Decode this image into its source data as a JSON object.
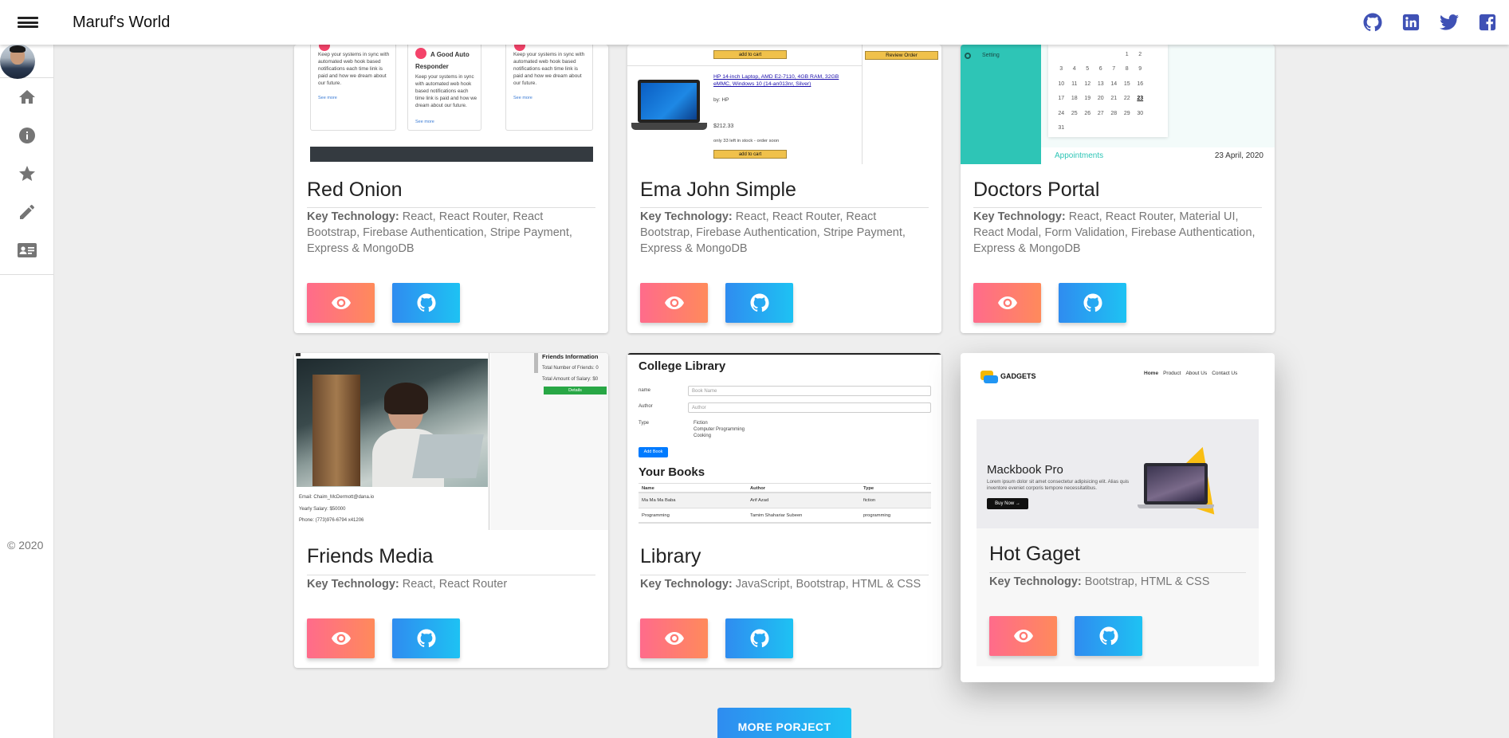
{
  "app": {
    "title": "Maruf's World"
  },
  "social": [
    {
      "icon": "github-icon",
      "label": "GitHub"
    },
    {
      "icon": "linkedin-icon",
      "label": "LinkedIn"
    },
    {
      "icon": "twitter-icon",
      "label": "Twitter"
    },
    {
      "icon": "facebook-icon",
      "label": "Facebook"
    }
  ],
  "drawer": {
    "items": [
      {
        "name": "home",
        "icon": "home-icon"
      },
      {
        "name": "about",
        "icon": "info-icon"
      },
      {
        "name": "skills",
        "icon": "star-icon"
      },
      {
        "name": "blog",
        "icon": "pencil-icon"
      },
      {
        "name": "contact",
        "icon": "contact-card-icon"
      }
    ],
    "copyright": "© 2020"
  },
  "tech_label": "Key Technology:",
  "projects": [
    {
      "title": "Red Onion",
      "tech": "React, React Router, React Bootstrap, Firebase Authentication, Stripe Payment, Express & MongoDB",
      "thumb": {
        "heading": "A Good Auto Responder",
        "body": "Keep your systems in sync with automated web hook based notifications each time link is paid and how we dream about our future.",
        "link": "See more"
      }
    },
    {
      "title": "Ema John Simple",
      "tech": "React, React Router, React Bootstrap, Firebase Authentication, Stripe Payment, Express & MongoDB",
      "thumb": {
        "add_to_cart": "add to cart",
        "review_order": "Review Order",
        "product": "HP 14-inch Laptop, AMD E2-7110, 4GB RAM, 32GB eMMC, Windows 10 (14-an013nr, Silver)",
        "by": "by: HP",
        "price": "$212.33",
        "stock": "only 33 left in stock - order soon"
      }
    },
    {
      "title": "Doctors Portal",
      "tech": "React, React Router, Material UI, React Modal, Form Validation, Firebase Authentication, Express & MongoDB",
      "thumb": {
        "setting": "Setting",
        "appointments": "Appointments",
        "date": "23 April, 2020",
        "calendar": [
          [
            "",
            "",
            "",
            "",
            "",
            "1",
            "2"
          ],
          [
            "3",
            "4",
            "5",
            "6",
            "7",
            "8",
            "9"
          ],
          [
            "10",
            "11",
            "12",
            "13",
            "14",
            "15",
            "16"
          ],
          [
            "17",
            "18",
            "19",
            "20",
            "21",
            "22",
            "23"
          ],
          [
            "24",
            "25",
            "26",
            "27",
            "28",
            "29",
            "30"
          ],
          [
            "31",
            "",
            "",
            "",
            "",
            "",
            ""
          ]
        ]
      }
    },
    {
      "title": "Friends Media",
      "tech": "React, React Router",
      "thumb": {
        "panel_title": "Friends Information",
        "friends_count": "Total Number of Friends: 0",
        "salary_total": "Total Amount of Salary: $0",
        "details": "Details",
        "email": "Email: Chaim_McDermott@dana.io",
        "salary": "Yearly Salary: $50000",
        "phone": "Phone: (773)976-6794 x41206"
      }
    },
    {
      "title": "Library",
      "tech": "JavaScript, Bootstrap, HTML & CSS",
      "thumb": {
        "heading": "College Library",
        "name_label": "name",
        "name_ph": "Book Name",
        "author_label": "Author",
        "author_ph": "Author",
        "type_label": "Type",
        "types": [
          "Fiction",
          "Computer Programming",
          "Cooking"
        ],
        "add": "Add Book",
        "books_heading": "Your Books",
        "cols": [
          "Name",
          "Author",
          "Type"
        ],
        "rows": [
          [
            "Ma Ma Ma Baba",
            "Arif Azad",
            "fiction"
          ],
          [
            "Programming",
            "Tamim Shahariar Subeen",
            "programming"
          ]
        ]
      }
    },
    {
      "title": "Hot Gaget",
      "tech": "Bootstrap, HTML & CSS",
      "thumb": {
        "brand": "GADGETS",
        "nav": [
          "Home",
          "Product",
          "About Us",
          "Contact Us"
        ],
        "hero_title": "Mackbook Pro",
        "hero_text": "Lorem ipsum dolor sit amet consectetur adipisicing elit. Alias quis inventore eveniet corporis tempore necessitatibus.",
        "buy": "Buy Now →"
      }
    }
  ],
  "more_button": "MORE PORJECT"
}
